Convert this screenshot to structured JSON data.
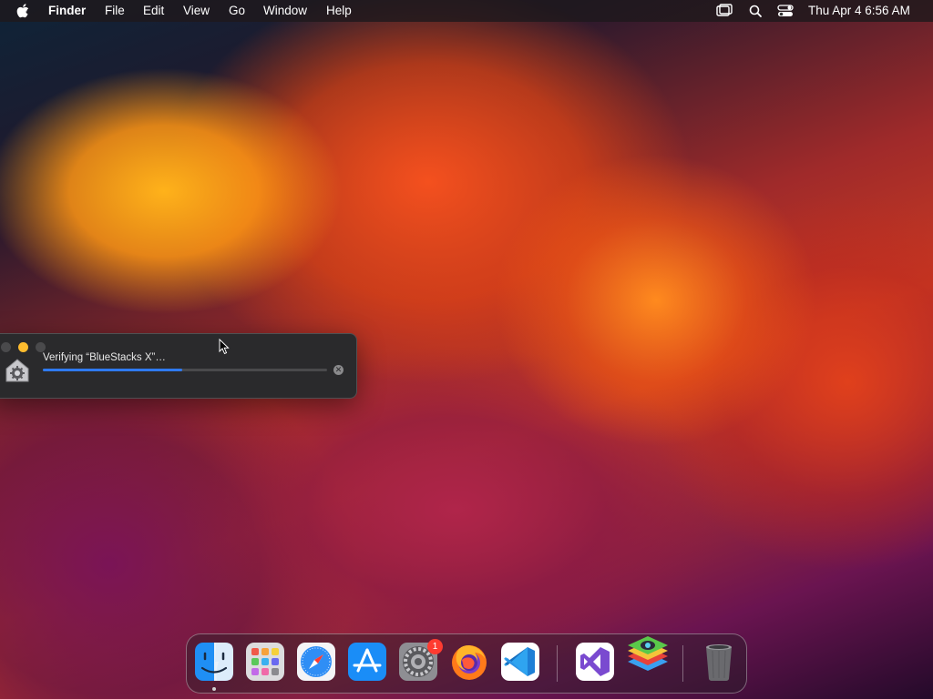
{
  "menubar": {
    "apple_icon": "apple-logo-icon",
    "app_name": "Finder",
    "menus": [
      "File",
      "Edit",
      "View",
      "Go",
      "Window",
      "Help"
    ],
    "status_icons": [
      "screen-mirroring-icon",
      "spotlight-search-icon",
      "control-center-icon"
    ],
    "clock": "Thu Apr 4  6:56 AM"
  },
  "dialog": {
    "title": "Verifying “BlueStacks X”…",
    "progress_fraction": 0.49,
    "cancel_icon": "stop-icon",
    "app_icon": "installer-icon"
  },
  "dock": {
    "apps": [
      {
        "name": "Finder",
        "icon": "finder-icon",
        "running": true
      },
      {
        "name": "Launchpad",
        "icon": "launchpad-icon",
        "running": false
      },
      {
        "name": "Safari",
        "icon": "safari-icon",
        "running": false
      },
      {
        "name": "App Store",
        "icon": "app-store-icon",
        "running": false
      },
      {
        "name": "System Settings",
        "icon": "system-settings-icon",
        "running": false,
        "badge": "1"
      },
      {
        "name": "Firefox",
        "icon": "firefox-icon",
        "running": false
      },
      {
        "name": "Visual Studio Code",
        "icon": "vscode-icon",
        "running": false
      },
      {
        "name": "Visual Studio",
        "icon": "visual-studio-icon",
        "running": false
      },
      {
        "name": "BlueStacks",
        "icon": "bluestacks-icon",
        "running": false
      },
      {
        "name": "Trash",
        "icon": "trash-icon",
        "running": false
      }
    ]
  },
  "colors": {
    "accent": "#2f7af0",
    "close": "#ff5f57",
    "minimize": "#febc2e",
    "badge": "#ff3b30"
  }
}
